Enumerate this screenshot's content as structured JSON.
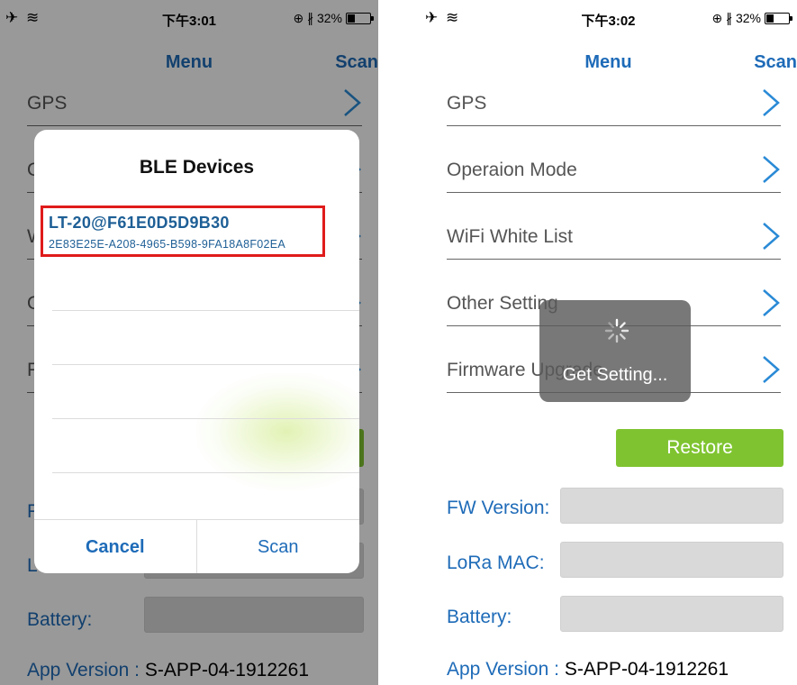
{
  "status_bar": {
    "left_icons": "✈ ≋",
    "time_left": "下午3:01",
    "time_right": "下午3:02",
    "right_status": "⊕ ∦ 32%"
  },
  "nav": {
    "title": "Menu",
    "scan": "Scan"
  },
  "menu_items": [
    {
      "label": "GPS",
      "icon": "chevron-right-icon"
    },
    {
      "label": "Operaion Mode",
      "icon": "chevron-right-icon"
    },
    {
      "label": "WiFi White List",
      "icon": "chevron-right-icon"
    },
    {
      "label": "Other Setting",
      "icon": "chevron-right-icon"
    },
    {
      "label": "Firmware Upgrade",
      "icon": "chevron-right-icon"
    }
  ],
  "restore_label": "Restore",
  "info": {
    "fw_version_label": "FW Version:",
    "lora_mac_label": "LoRa MAC:",
    "battery_label": "Battery:",
    "app_version_label": "App Version :",
    "app_version_value": "S-APP-04-1912261"
  },
  "ble_dialog": {
    "title": "BLE Devices",
    "devices": [
      {
        "name": "LT-20@F61E0D5D9B30",
        "uuid": "2E83E25E-A208-4965-B598-9FA18A8F02EA"
      }
    ],
    "cancel_label": "Cancel",
    "scan_label": "Scan"
  },
  "hud": {
    "text": "Get Setting..."
  },
  "colors": {
    "accent_blue": "#1e6bb8",
    "restore_green": "#7fc430",
    "highlight_red": "#e01b1b"
  }
}
